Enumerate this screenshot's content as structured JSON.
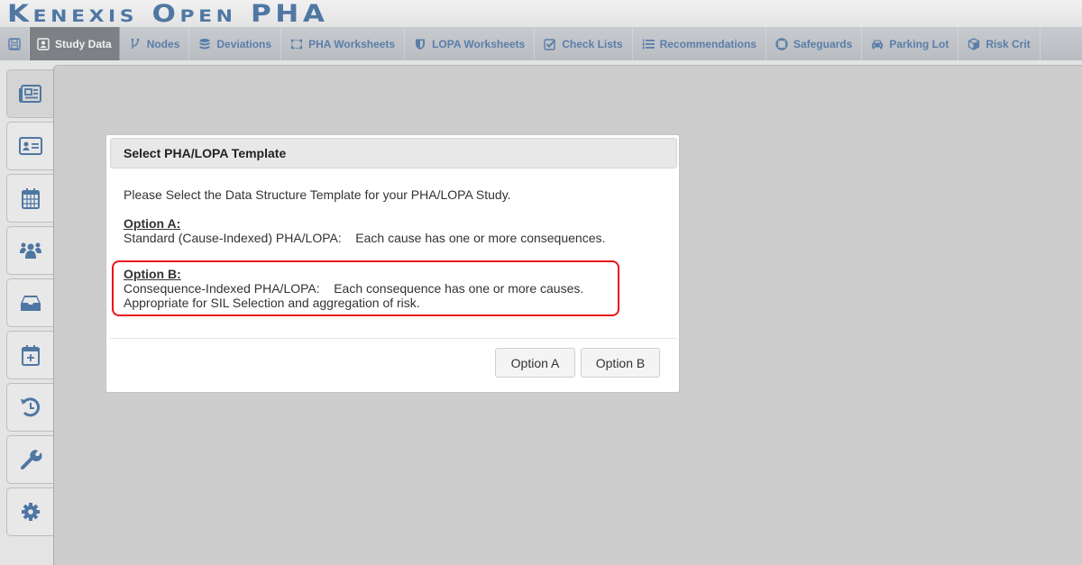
{
  "app": {
    "title": "Kenexis Open PHA"
  },
  "navbar": {
    "items": [
      {
        "label": "",
        "icon": "save-icon"
      },
      {
        "label": "Study Data",
        "icon": "id-card-icon",
        "active": true
      },
      {
        "label": "Nodes",
        "icon": "nodes-icon"
      },
      {
        "label": "Deviations",
        "icon": "database-icon"
      },
      {
        "label": "PHA Worksheets",
        "icon": "worksheet-icon"
      },
      {
        "label": "LOPA Worksheets",
        "icon": "shield-icon"
      },
      {
        "label": "Check Lists",
        "icon": "checkbox-icon"
      },
      {
        "label": "Recommendations",
        "icon": "list-ordered-icon"
      },
      {
        "label": "Safeguards",
        "icon": "life-ring-icon"
      },
      {
        "label": "Parking Lot",
        "icon": "car-icon"
      },
      {
        "label": "Risk Crit",
        "icon": "cube-icon"
      }
    ]
  },
  "sidebar": {
    "items": [
      {
        "icon": "newspaper-icon",
        "active": true
      },
      {
        "icon": "address-card-icon"
      },
      {
        "icon": "calendar-icon"
      },
      {
        "icon": "users-icon"
      },
      {
        "icon": "inbox-icon"
      },
      {
        "icon": "calendar-plus-icon"
      },
      {
        "icon": "history-icon"
      },
      {
        "icon": "wrench-icon"
      },
      {
        "icon": "gear-icon"
      }
    ]
  },
  "modal": {
    "title": "Select PHA/LOPA Template",
    "intro": "Please Select the Data Structure Template for your PHA/LOPA Study.",
    "option_a": {
      "title": "Option A:",
      "text": "Standard (Cause-Indexed) PHA/LOPA:    Each cause has one or more consequences."
    },
    "option_b": {
      "title": "Option B:",
      "text": "Consequence-Indexed PHA/LOPA:    Each consequence has one or more causes.",
      "text2": "Appropriate for SIL Selection and aggregation of risk."
    },
    "buttons": {
      "option_a": "Option A",
      "option_b": "Option B"
    }
  },
  "colors": {
    "brand": "#4f77a3",
    "highlight": "#e8141b",
    "nav_active": "#7d8084"
  }
}
